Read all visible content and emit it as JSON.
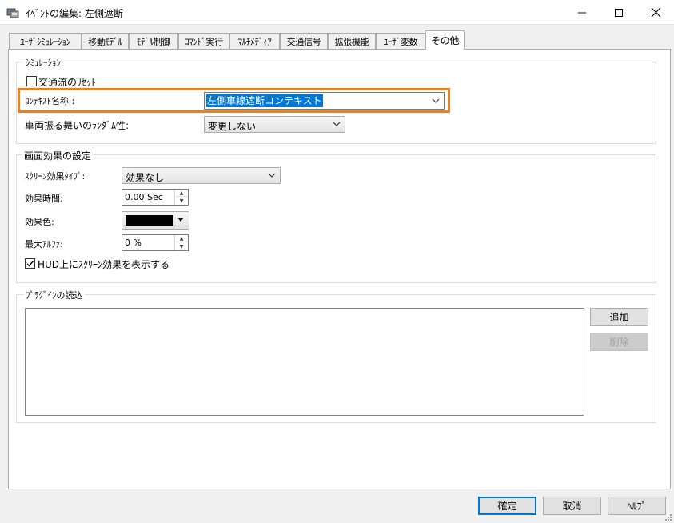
{
  "window": {
    "title": "ｲﾍﾞﾝﾄの編集: 左側遮断",
    "controls": {
      "minimize": "—",
      "maximize": "☐",
      "close": "✕"
    }
  },
  "tabs": [
    {
      "label": "ﾕｰｻﾞｼﾐｭﾚｰｼｮﾝ",
      "active": false
    },
    {
      "label": "移動ﾓﾃﾞﾙ",
      "active": false
    },
    {
      "label": "ﾓﾃﾞﾙ制御",
      "active": false
    },
    {
      "label": "ｺﾏﾝﾄﾞ実行",
      "active": false
    },
    {
      "label": "ﾏﾙﾁﾒﾃﾞｨｱ",
      "active": false
    },
    {
      "label": "交通信号",
      "active": false
    },
    {
      "label": "拡張機能",
      "active": false
    },
    {
      "label": "ﾕｰｻﾞ変数",
      "active": false
    },
    {
      "label": "その他",
      "active": true
    }
  ],
  "simulation": {
    "legend": "ｼﾐｭﾚｰｼｮﾝ",
    "reset_checkbox": {
      "label": "交通流のﾘｾｯﾄ",
      "checked": false
    },
    "context_name": {
      "label": "ｺﾝﾃｷｽﾄ名称 :",
      "value": "左側車線遮断コンテキスト"
    },
    "randomness": {
      "label": "車両振る舞いのﾗﾝﾀﾞﾑ性:",
      "value": "変更しない"
    }
  },
  "screen_effect": {
    "legend": "画面効果の設定",
    "type": {
      "label": "ｽｸﾘｰﾝ効果ﾀｲﾌﾟ:",
      "value": "効果なし"
    },
    "duration": {
      "label": "効果時間:",
      "value": "0.00 Sec"
    },
    "color": {
      "label": "効果色:",
      "value": "#000000"
    },
    "max_alpha": {
      "label": "最大ｱﾙﾌｧ:",
      "value": "0 %"
    },
    "hud_checkbox": {
      "label": "HUD上にｽｸﾘｰﾝ効果を表示する",
      "checked": true
    }
  },
  "plugins": {
    "legend": "ﾌﾟﾗｸﾞｲﾝの読込",
    "add_button": "追加",
    "delete_button": "削除"
  },
  "footer": {
    "ok_button": "確定",
    "cancel_button": "取消",
    "help_button": "ﾍﾙﾌﾟ"
  },
  "colors": {
    "highlight": "#f07f1b",
    "selection": "#0078d7",
    "accent": "#0078d7"
  }
}
